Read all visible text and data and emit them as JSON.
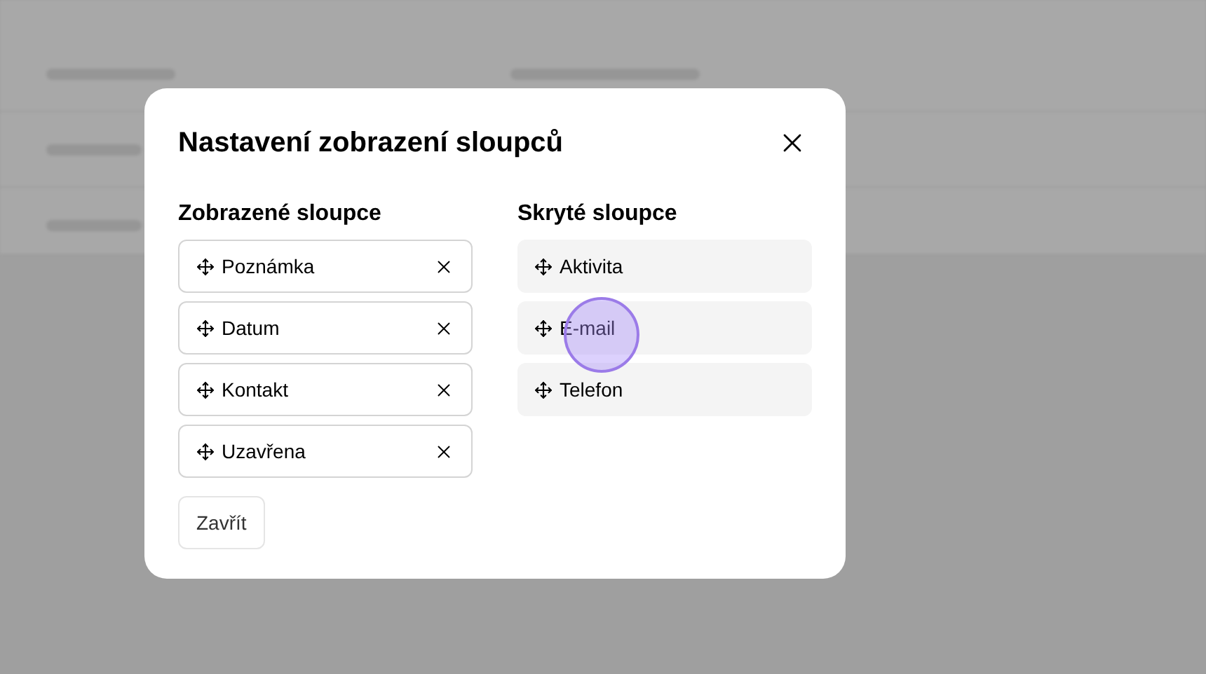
{
  "dialog": {
    "title": "Nastavení zobrazení sloupců",
    "visible_columns": {
      "heading": "Zobrazené sloupce",
      "items": [
        "Poznámka",
        "Datum",
        "Kontakt",
        "Uzavřena"
      ]
    },
    "hidden_columns": {
      "heading": "Skryté sloupce",
      "items": [
        "Aktivita",
        "E-mail",
        "Telefon"
      ]
    },
    "close_button": "Zavřít"
  }
}
